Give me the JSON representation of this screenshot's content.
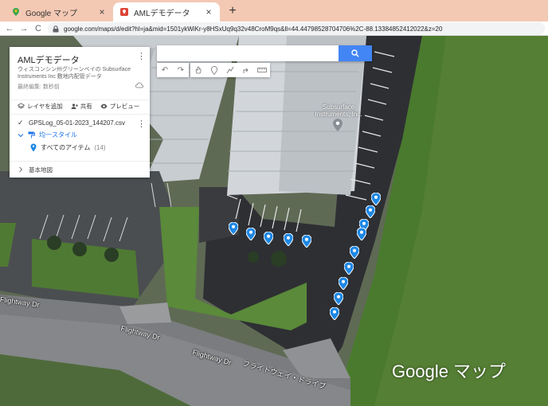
{
  "browser": {
    "tabs": [
      {
        "title": "Google マップ",
        "active": false,
        "close": "×"
      },
      {
        "title": "AMLデモデータ",
        "active": true,
        "close": "×"
      }
    ],
    "new_tab": "+",
    "back": "←",
    "forward": "→",
    "reload": "C",
    "url": "google.com/maps/d/edit?hl=ja&mid=1501ykWiKr-y8HSxUq9q32v48CroM9qs&ll=44.44798528704706%2C-88.13384852412022&z=20"
  },
  "panel": {
    "title": "AMLデモデータ",
    "menu": "⋮",
    "description": "ウィスコンシン州グリーンベイの Subsurface Instruments Inc 敷地内配管データ",
    "edited": "最終編集: 数秒前",
    "actions": {
      "add_layer": "レイヤを追加",
      "share": "共有",
      "preview": "プレビュー"
    },
    "layer": {
      "name": "GPSLog_05-01-2023_144207.csv",
      "menu": "⋮",
      "style": "均一スタイル",
      "all_items": "すべてのアイテム",
      "count": "(14)"
    },
    "basemap": "基本地図"
  },
  "search": {
    "value": "",
    "placeholder": ""
  },
  "map": {
    "poi_name": "Subsurface Instruments, Inc.",
    "roads": [
      "Flightway Dr",
      "Flightway Dr",
      "Flightway Dr",
      "フライトウェイ・ドライブ"
    ],
    "logo": "Google マップ",
    "marker_count": 14,
    "marker_color": "#1e88e5"
  }
}
